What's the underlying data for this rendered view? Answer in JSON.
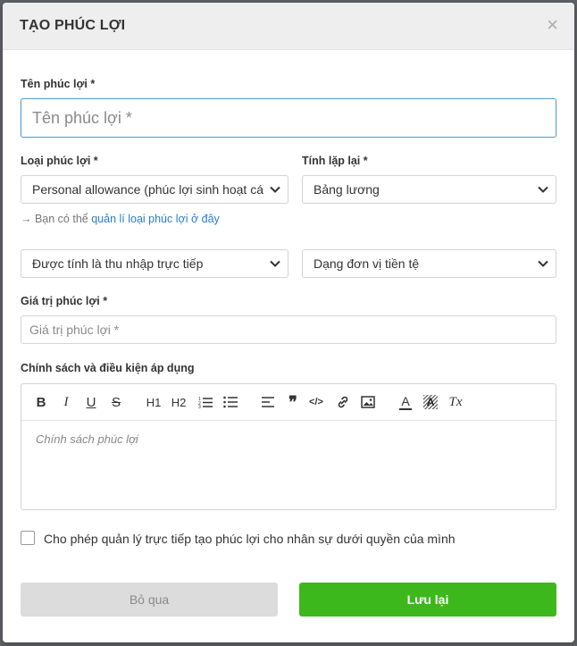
{
  "dialog": {
    "title": "TẠO PHÚC LỢI",
    "close_symbol": "×"
  },
  "form": {
    "name": {
      "label": "Tên phúc lợi *",
      "placeholder": "Tên phúc lợi *",
      "value": ""
    },
    "type": {
      "label": "Loại phúc lợi *",
      "selected": "Personal allowance (phúc lợi sinh hoạt cá"
    },
    "repeat": {
      "label": "Tính lặp lại *",
      "selected": "Bảng lương"
    },
    "hint": {
      "prefix": "→ Bạn có thể ",
      "link": "quản lí loại phúc lợi ở đây"
    },
    "income": {
      "selected": "Được tính là thu nhập trực tiếp"
    },
    "unit": {
      "selected": "Dạng đơn vị tiền tệ"
    },
    "value": {
      "label": "Giá trị phúc lợi *",
      "placeholder": "Giá trị phúc lợi *",
      "value": ""
    },
    "policy": {
      "label": "Chính sách và điều kiện áp dụng",
      "placeholder": "Chính sách phúc lợi"
    },
    "allow_manager": {
      "label": "Cho phép quản lý trực tiếp tạo phúc lợi cho nhân sự dưới quyền của mình",
      "checked": false
    }
  },
  "toolbar": {
    "bold": "B",
    "italic": "I",
    "underline": "U",
    "strike": "S",
    "h1": "H1",
    "h2": "H2",
    "quote": "❞",
    "code": "</>",
    "font_color": "A",
    "clear_format": "Tx",
    "icons": [
      "bold-icon",
      "italic-icon",
      "underline-icon",
      "strikethrough-icon",
      "heading1-icon",
      "heading2-icon",
      "ordered-list-icon",
      "bullet-list-icon",
      "align-icon",
      "quote-icon",
      "code-icon",
      "link-icon",
      "image-icon",
      "font-color-icon",
      "background-color-icon",
      "clear-format-icon"
    ]
  },
  "actions": {
    "cancel": "Bỏ qua",
    "save": "Lưu lại"
  },
  "colors": {
    "primary": "#3cb81c",
    "link": "#2a7ec9",
    "focus_border": "#5a9fd6"
  }
}
